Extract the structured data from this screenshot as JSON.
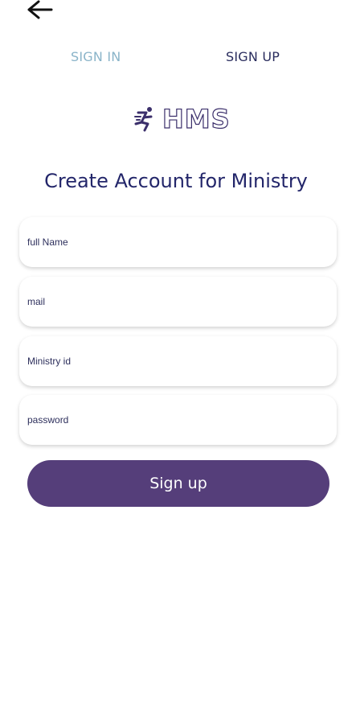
{
  "header": {
    "back_icon": "arrow-left-icon"
  },
  "tabs": {
    "sign_in": "SIGN IN",
    "sign_up": "SIGN UP",
    "active": "sign_up"
  },
  "logo": {
    "text": "HMS",
    "icon": "runner-logo-icon"
  },
  "form": {
    "title": "Create Account for Ministry",
    "full_name_placeholder": "full Name",
    "mail_placeholder": "mail",
    "ministry_id_placeholder": "Ministry id",
    "password_placeholder": "password",
    "submit_label": "Sign up"
  },
  "colors": {
    "primary": "#553e7a",
    "title": "#23266a",
    "inactive_tab": "#8ab4c9",
    "active_tab": "#2a2d5e"
  }
}
